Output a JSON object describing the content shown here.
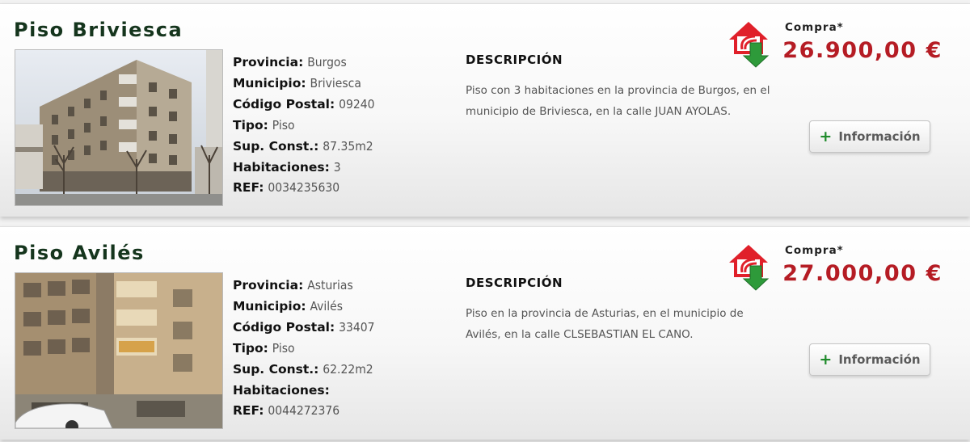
{
  "colors": {
    "title": "#15351d",
    "price": "#b51c24",
    "icon_red": "#e0202a",
    "icon_green": "#2e9a3a",
    "plus": "#1e8a2a"
  },
  "listings": [
    {
      "title": "Piso Briviesca",
      "photo_icon": "building-photo",
      "details": [
        {
          "label": "Provincia:",
          "value": "Burgos"
        },
        {
          "label": "Municipio:",
          "value": "Briviesca"
        },
        {
          "label": "Código Postal:",
          "value": "09240"
        },
        {
          "label": "Tipo:",
          "value": "Piso"
        },
        {
          "label": "Sup. Const.:",
          "value": "87.35m2"
        },
        {
          "label": "Habitaciones:",
          "value": "3"
        },
        {
          "label": "REF:",
          "value": "0034235630"
        }
      ],
      "description_heading": "DESCRIPCIÓN",
      "description": "Piso con 3 habitaciones en la provincia de Burgos, en el municipio de Briviesca, en la calle JUAN AYOLAS.",
      "buy_label": "Compra*",
      "price": "26.900,00 €",
      "info_button": "Información",
      "buy_icon": "house-buy-icon",
      "plus_icon": "+"
    },
    {
      "title": "Piso Avilés",
      "photo_icon": "building-photo",
      "details": [
        {
          "label": "Provincia:",
          "value": "Asturias"
        },
        {
          "label": "Municipio:",
          "value": "Avilés"
        },
        {
          "label": "Código Postal:",
          "value": "33407"
        },
        {
          "label": "Tipo:",
          "value": "Piso"
        },
        {
          "label": "Sup. Const.:",
          "value": "62.22m2"
        },
        {
          "label": "Habitaciones:",
          "value": ""
        },
        {
          "label": "REF:",
          "value": "0044272376"
        }
      ],
      "description_heading": "DESCRIPCIÓN",
      "description": "Piso en la provincia de Asturias, en el municipio de Avilés, en la calle CLSEBASTIAN EL CANO.",
      "buy_label": "Compra*",
      "price": "27.000,00 €",
      "info_button": "Información",
      "buy_icon": "house-buy-icon",
      "plus_icon": "+"
    }
  ]
}
